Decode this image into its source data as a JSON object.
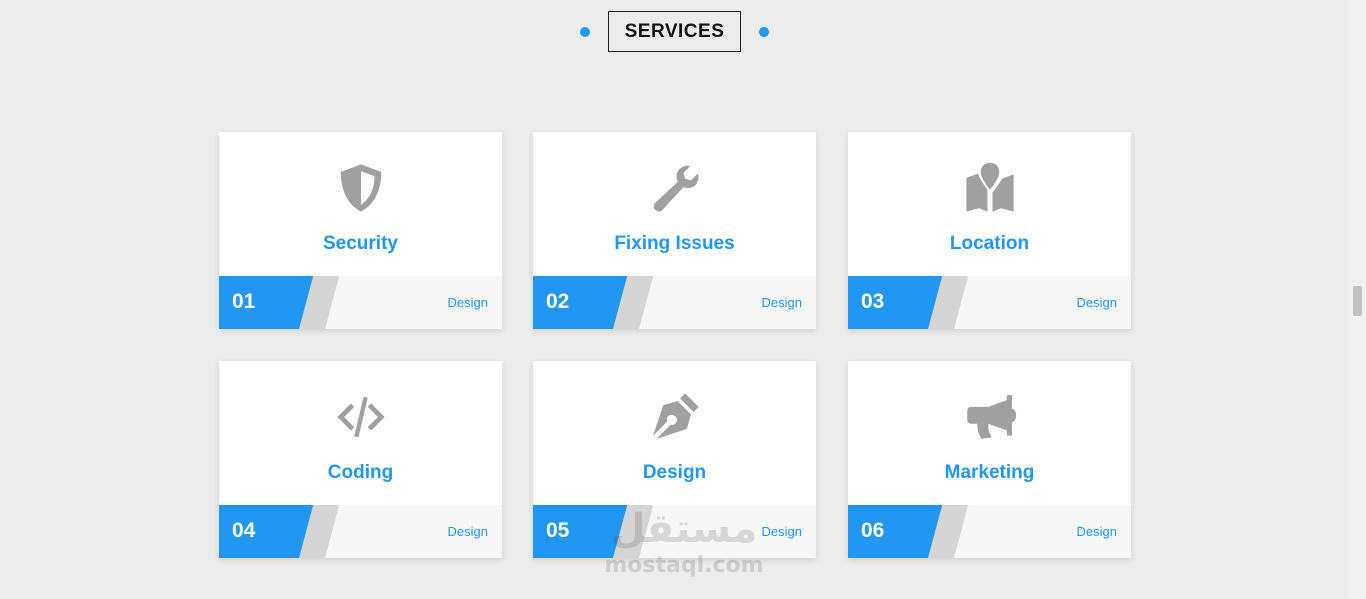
{
  "section": {
    "heading": "SERVICES",
    "accent_color": "#2196f3"
  },
  "cards": [
    {
      "number": "01",
      "title": "Security",
      "tag": "Design",
      "icon": "shield-icon"
    },
    {
      "number": "02",
      "title": "Fixing Issues",
      "tag": "Design",
      "icon": "wrench-icon"
    },
    {
      "number": "03",
      "title": "Location",
      "tag": "Design",
      "icon": "map-location-icon"
    },
    {
      "number": "04",
      "title": "Coding",
      "tag": "Design",
      "icon": "code-icon"
    },
    {
      "number": "05",
      "title": "Design",
      "tag": "Design",
      "icon": "pen-nib-icon"
    },
    {
      "number": "06",
      "title": "Marketing",
      "tag": "Design",
      "icon": "megaphone-icon"
    }
  ],
  "watermark": {
    "arabic": "مستقل",
    "latin": "mostaql.com"
  }
}
